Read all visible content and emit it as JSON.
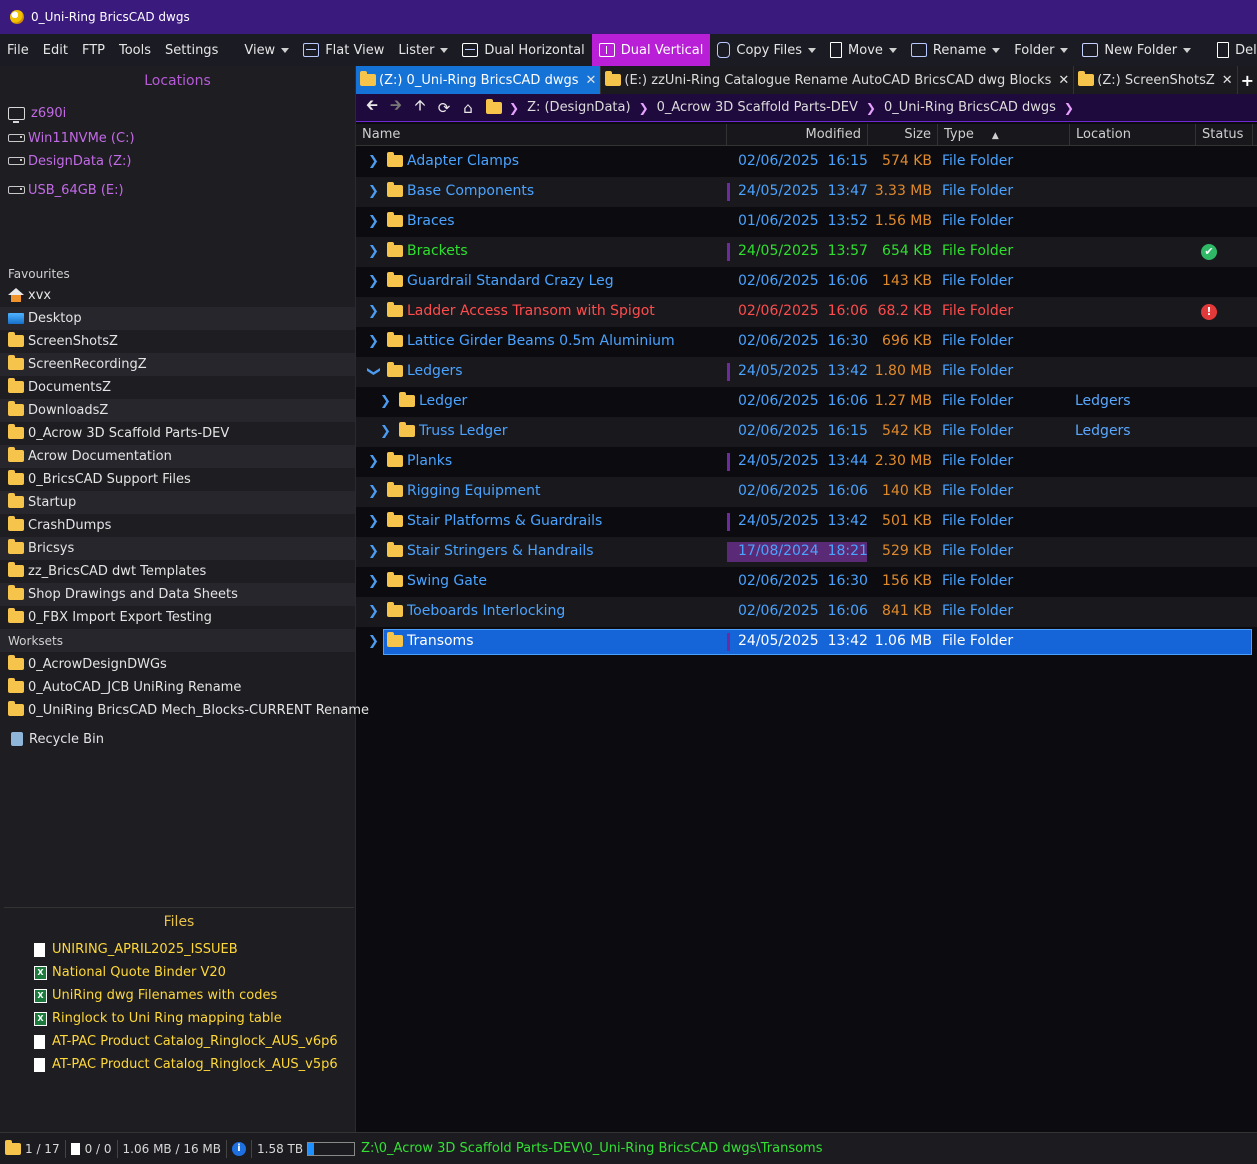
{
  "window": {
    "title": "0_Uni-Ring BricsCAD dwgs"
  },
  "menu": [
    "File",
    "Edit",
    "FTP",
    "Tools",
    "Settings"
  ],
  "toolbar": {
    "view": "View",
    "flat_view": "Flat View",
    "lister": "Lister",
    "dual_horizontal": "Dual Horizontal",
    "dual_vertical": "Dual Vertical",
    "copy_files": "Copy Files",
    "move": "Move",
    "rename": "Rename",
    "folder": "Folder",
    "new_folder": "New Folder",
    "delete": "Del"
  },
  "sidebar": {
    "locations_title": "Locations",
    "locations": [
      "z690i",
      "Win11NVMe (C:)",
      "DesignData (Z:)",
      "USB_64GB (E:)"
    ],
    "favourites_title": "Favourites",
    "favourites": [
      {
        "label": "xvx",
        "icon": "home-icon"
      },
      {
        "label": "Desktop",
        "icon": "desktop-icon"
      },
      {
        "label": "ScreenShotsZ",
        "icon": "folder-icon"
      },
      {
        "label": "ScreenRecordingZ",
        "icon": "folder-icon"
      },
      {
        "label": "DocumentsZ",
        "icon": "folder-icon"
      },
      {
        "label": "DownloadsZ",
        "icon": "folder-icon"
      },
      {
        "label": "0_Acrow 3D Scaffold Parts-DEV",
        "icon": "folder-icon"
      },
      {
        "label": "Acrow Documentation",
        "icon": "folder-icon"
      },
      {
        "label": "0_BricsCAD Support Files",
        "icon": "folder-icon"
      },
      {
        "label": "Startup",
        "icon": "folder-icon"
      },
      {
        "label": "CrashDumps",
        "icon": "folder-icon"
      },
      {
        "label": "Bricsys",
        "icon": "folder-icon"
      },
      {
        "label": "zz_BricsCAD dwt Templates",
        "icon": "folder-icon"
      },
      {
        "label": "Shop Drawings and Data Sheets",
        "icon": "folder-icon"
      },
      {
        "label": "0_FBX Import Export Testing",
        "icon": "folder-icon"
      }
    ],
    "worksets_title": "Worksets",
    "worksets": [
      "0_AcrowDesignDWGs",
      "0_AutoCAD_JCB UniRing Rename",
      "0_UniRing BricsCAD Mech_Blocks-CURRENT Rename"
    ],
    "recycle_bin": "Recycle Bin",
    "files_title": "Files",
    "files": [
      {
        "label": "UNIRING_APRIL2025_ISSUEB",
        "icon": "doc-icon"
      },
      {
        "label": "National Quote Binder V20",
        "icon": "xls-icon"
      },
      {
        "label": "UniRing dwg Filenames with codes",
        "icon": "xls-icon"
      },
      {
        "label": "Ringlock to Uni Ring mapping table",
        "icon": "xls-icon"
      },
      {
        "label": "AT-PAC Product Catalog_Ringlock_AUS_v6p6",
        "icon": "doc-icon"
      },
      {
        "label": "AT-PAC Product Catalog_Ringlock_AUS_v5p6",
        "icon": "doc-icon"
      }
    ]
  },
  "tabs": [
    {
      "label": "(Z:) 0_Uni-Ring BricsCAD dwgs",
      "active": true
    },
    {
      "label": "(E:) zzUni-Ring Catalogue Rename AutoCAD BricsCAD dwg Blocks",
      "active": false
    },
    {
      "label": "(Z:) ScreenShotsZ",
      "active": false
    }
  ],
  "breadcrumb": [
    "Z: (DesignData)",
    "0_Acrow 3D Scaffold Parts-DEV",
    "0_Uni-Ring BricsCAD dwgs"
  ],
  "columns": {
    "name": "Name",
    "modified": "Modified",
    "size": "Size",
    "type": "Type",
    "location": "Location",
    "status": "Status"
  },
  "rows": [
    {
      "name": "Adapter Clamps",
      "date": "02/06/2025",
      "time": "16:15",
      "size": "574 KB",
      "type": "File Folder",
      "color": "blue",
      "level": 0,
      "expanded": false,
      "location": "",
      "status": "",
      "mark": ""
    },
    {
      "name": "Base Components",
      "date": "24/05/2025",
      "time": "13:47",
      "size": "3.33 MB",
      "type": "File Folder",
      "color": "blue",
      "level": 0,
      "expanded": false,
      "location": "",
      "status": "",
      "mark": "bar"
    },
    {
      "name": "Braces",
      "date": "01/06/2025",
      "time": "13:52",
      "size": "1.56 MB",
      "type": "File Folder",
      "color": "blue",
      "level": 0,
      "expanded": false,
      "location": "",
      "status": "",
      "mark": ""
    },
    {
      "name": "Brackets",
      "date": "24/05/2025",
      "time": "13:57",
      "size": "654 KB",
      "type": "File Folder",
      "color": "green",
      "level": 0,
      "expanded": false,
      "location": "",
      "status": "ok",
      "mark": "bar"
    },
    {
      "name": "Guardrail Standard Crazy Leg",
      "date": "02/06/2025",
      "time": "16:06",
      "size": "143 KB",
      "type": "File Folder",
      "color": "blue",
      "level": 0,
      "expanded": false,
      "location": "",
      "status": "",
      "mark": ""
    },
    {
      "name": "Ladder Access Transom with Spigot",
      "date": "02/06/2025",
      "time": "16:06",
      "size": "68.2 KB",
      "type": "File Folder",
      "color": "red",
      "level": 0,
      "expanded": false,
      "location": "",
      "status": "error",
      "mark": ""
    },
    {
      "name": "Lattice Girder Beams 0.5m Aluminium",
      "date": "02/06/2025",
      "time": "16:30",
      "size": "696 KB",
      "type": "File Folder",
      "color": "blue",
      "level": 0,
      "expanded": false,
      "location": "",
      "status": "",
      "mark": ""
    },
    {
      "name": "Ledgers",
      "date": "24/05/2025",
      "time": "13:42",
      "size": "1.80 MB",
      "type": "File Folder",
      "color": "blue",
      "level": 0,
      "expanded": true,
      "location": "",
      "status": "",
      "mark": "bar"
    },
    {
      "name": "Ledger",
      "date": "02/06/2025",
      "time": "16:06",
      "size": "1.27 MB",
      "type": "File Folder",
      "color": "blue",
      "level": 1,
      "expanded": false,
      "location": "Ledgers",
      "status": "",
      "mark": ""
    },
    {
      "name": "Truss Ledger",
      "date": "02/06/2025",
      "time": "16:15",
      "size": "542 KB",
      "type": "File Folder",
      "color": "blue",
      "level": 1,
      "expanded": false,
      "location": "Ledgers",
      "status": "",
      "mark": ""
    },
    {
      "name": "Planks",
      "date": "24/05/2025",
      "time": "13:44",
      "size": "2.30 MB",
      "type": "File Folder",
      "color": "blue",
      "level": 0,
      "expanded": false,
      "location": "",
      "status": "",
      "mark": "bar"
    },
    {
      "name": "Rigging Equipment",
      "date": "02/06/2025",
      "time": "16:06",
      "size": "140 KB",
      "type": "File Folder",
      "color": "blue",
      "level": 0,
      "expanded": false,
      "location": "",
      "status": "",
      "mark": ""
    },
    {
      "name": "Stair Platforms & Guardrails",
      "date": "24/05/2025",
      "time": "13:42",
      "size": "501 KB",
      "type": "File Folder",
      "color": "blue",
      "level": 0,
      "expanded": false,
      "location": "",
      "status": "",
      "mark": "bar"
    },
    {
      "name": "Stair Stringers & Handrails",
      "date": "17/08/2024",
      "time": "18:21",
      "size": "529 KB",
      "type": "File Folder",
      "color": "blue",
      "level": 0,
      "expanded": false,
      "location": "",
      "status": "",
      "mark": "highlight"
    },
    {
      "name": "Swing Gate",
      "date": "02/06/2025",
      "time": "16:30",
      "size": "156 KB",
      "type": "File Folder",
      "color": "blue",
      "level": 0,
      "expanded": false,
      "location": "",
      "status": "",
      "mark": ""
    },
    {
      "name": "Toeboards Interlocking",
      "date": "02/06/2025",
      "time": "16:06",
      "size": "841 KB",
      "type": "File Folder",
      "color": "blue",
      "level": 0,
      "expanded": false,
      "location": "",
      "status": "",
      "mark": ""
    },
    {
      "name": "Transoms",
      "date": "24/05/2025",
      "time": "13:42",
      "size": "1.06 MB",
      "type": "File Folder",
      "color": "white",
      "level": 0,
      "expanded": false,
      "location": "",
      "status": "",
      "mark": "bar",
      "selected": true
    }
  ],
  "statusbar": {
    "folders": "1 / 17",
    "files": "0 / 0",
    "size": "1.06 MB / 16 MB",
    "disk_free": "1.58 TB",
    "disk_used_fraction": 0.12,
    "path": "Z:\\0_Acrow 3D Scaffold Parts-DEV\\0_Uni-Ring BricsCAD dwgs\\Transoms"
  },
  "colors": {
    "accent": "#b81fd6",
    "selection": "#1565d8",
    "title_bar": "#3b1a7e"
  }
}
